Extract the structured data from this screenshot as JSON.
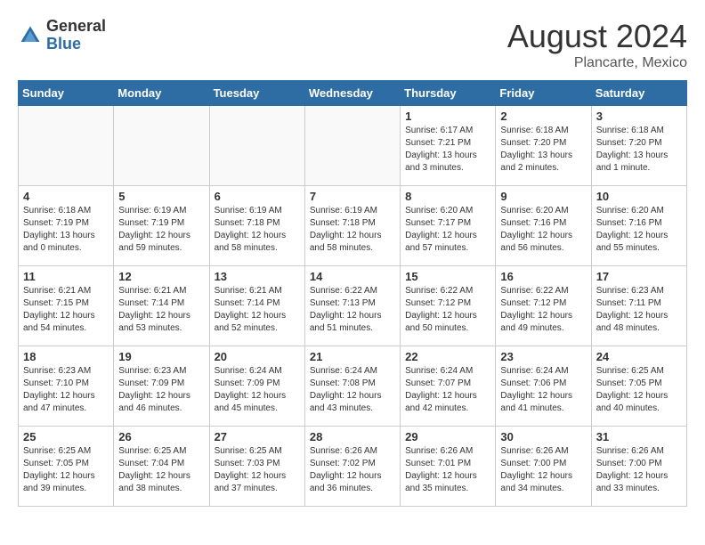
{
  "logo": {
    "general": "General",
    "blue": "Blue"
  },
  "header": {
    "month_year": "August 2024",
    "location": "Plancarte, Mexico"
  },
  "weekdays": [
    "Sunday",
    "Monday",
    "Tuesday",
    "Wednesday",
    "Thursday",
    "Friday",
    "Saturday"
  ],
  "weeks": [
    [
      {
        "day": "",
        "info": ""
      },
      {
        "day": "",
        "info": ""
      },
      {
        "day": "",
        "info": ""
      },
      {
        "day": "",
        "info": ""
      },
      {
        "day": "1",
        "info": "Sunrise: 6:17 AM\nSunset: 7:21 PM\nDaylight: 13 hours\nand 3 minutes."
      },
      {
        "day": "2",
        "info": "Sunrise: 6:18 AM\nSunset: 7:20 PM\nDaylight: 13 hours\nand 2 minutes."
      },
      {
        "day": "3",
        "info": "Sunrise: 6:18 AM\nSunset: 7:20 PM\nDaylight: 13 hours\nand 1 minute."
      }
    ],
    [
      {
        "day": "4",
        "info": "Sunrise: 6:18 AM\nSunset: 7:19 PM\nDaylight: 13 hours\nand 0 minutes."
      },
      {
        "day": "5",
        "info": "Sunrise: 6:19 AM\nSunset: 7:19 PM\nDaylight: 12 hours\nand 59 minutes."
      },
      {
        "day": "6",
        "info": "Sunrise: 6:19 AM\nSunset: 7:18 PM\nDaylight: 12 hours\nand 58 minutes."
      },
      {
        "day": "7",
        "info": "Sunrise: 6:19 AM\nSunset: 7:18 PM\nDaylight: 12 hours\nand 58 minutes."
      },
      {
        "day": "8",
        "info": "Sunrise: 6:20 AM\nSunset: 7:17 PM\nDaylight: 12 hours\nand 57 minutes."
      },
      {
        "day": "9",
        "info": "Sunrise: 6:20 AM\nSunset: 7:16 PM\nDaylight: 12 hours\nand 56 minutes."
      },
      {
        "day": "10",
        "info": "Sunrise: 6:20 AM\nSunset: 7:16 PM\nDaylight: 12 hours\nand 55 minutes."
      }
    ],
    [
      {
        "day": "11",
        "info": "Sunrise: 6:21 AM\nSunset: 7:15 PM\nDaylight: 12 hours\nand 54 minutes."
      },
      {
        "day": "12",
        "info": "Sunrise: 6:21 AM\nSunset: 7:14 PM\nDaylight: 12 hours\nand 53 minutes."
      },
      {
        "day": "13",
        "info": "Sunrise: 6:21 AM\nSunset: 7:14 PM\nDaylight: 12 hours\nand 52 minutes."
      },
      {
        "day": "14",
        "info": "Sunrise: 6:22 AM\nSunset: 7:13 PM\nDaylight: 12 hours\nand 51 minutes."
      },
      {
        "day": "15",
        "info": "Sunrise: 6:22 AM\nSunset: 7:12 PM\nDaylight: 12 hours\nand 50 minutes."
      },
      {
        "day": "16",
        "info": "Sunrise: 6:22 AM\nSunset: 7:12 PM\nDaylight: 12 hours\nand 49 minutes."
      },
      {
        "day": "17",
        "info": "Sunrise: 6:23 AM\nSunset: 7:11 PM\nDaylight: 12 hours\nand 48 minutes."
      }
    ],
    [
      {
        "day": "18",
        "info": "Sunrise: 6:23 AM\nSunset: 7:10 PM\nDaylight: 12 hours\nand 47 minutes."
      },
      {
        "day": "19",
        "info": "Sunrise: 6:23 AM\nSunset: 7:09 PM\nDaylight: 12 hours\nand 46 minutes."
      },
      {
        "day": "20",
        "info": "Sunrise: 6:24 AM\nSunset: 7:09 PM\nDaylight: 12 hours\nand 45 minutes."
      },
      {
        "day": "21",
        "info": "Sunrise: 6:24 AM\nSunset: 7:08 PM\nDaylight: 12 hours\nand 43 minutes."
      },
      {
        "day": "22",
        "info": "Sunrise: 6:24 AM\nSunset: 7:07 PM\nDaylight: 12 hours\nand 42 minutes."
      },
      {
        "day": "23",
        "info": "Sunrise: 6:24 AM\nSunset: 7:06 PM\nDaylight: 12 hours\nand 41 minutes."
      },
      {
        "day": "24",
        "info": "Sunrise: 6:25 AM\nSunset: 7:05 PM\nDaylight: 12 hours\nand 40 minutes."
      }
    ],
    [
      {
        "day": "25",
        "info": "Sunrise: 6:25 AM\nSunset: 7:05 PM\nDaylight: 12 hours\nand 39 minutes."
      },
      {
        "day": "26",
        "info": "Sunrise: 6:25 AM\nSunset: 7:04 PM\nDaylight: 12 hours\nand 38 minutes."
      },
      {
        "day": "27",
        "info": "Sunrise: 6:25 AM\nSunset: 7:03 PM\nDaylight: 12 hours\nand 37 minutes."
      },
      {
        "day": "28",
        "info": "Sunrise: 6:26 AM\nSunset: 7:02 PM\nDaylight: 12 hours\nand 36 minutes."
      },
      {
        "day": "29",
        "info": "Sunrise: 6:26 AM\nSunset: 7:01 PM\nDaylight: 12 hours\nand 35 minutes."
      },
      {
        "day": "30",
        "info": "Sunrise: 6:26 AM\nSunset: 7:00 PM\nDaylight: 12 hours\nand 34 minutes."
      },
      {
        "day": "31",
        "info": "Sunrise: 6:26 AM\nSunset: 7:00 PM\nDaylight: 12 hours\nand 33 minutes."
      }
    ]
  ]
}
